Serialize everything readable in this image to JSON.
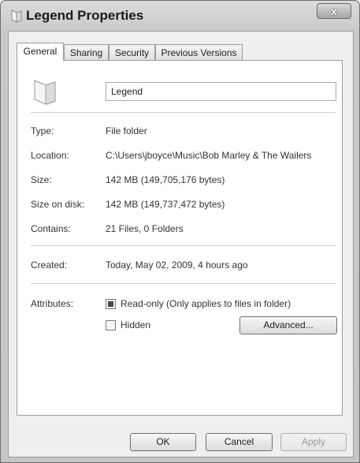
{
  "window": {
    "title": "Legend Properties",
    "close_glyph": "x"
  },
  "tabs": [
    {
      "label": "General"
    },
    {
      "label": "Sharing"
    },
    {
      "label": "Security"
    },
    {
      "label": "Previous Versions"
    }
  ],
  "general": {
    "name_value": "Legend",
    "rows": [
      {
        "label": "Type:",
        "value": "File folder"
      },
      {
        "label": "Location:",
        "value": "C:\\Users\\jboyce\\Music\\Bob Marley & The Wailers"
      },
      {
        "label": "Size:",
        "value": "142 MB (149,705,176 bytes)"
      },
      {
        "label": "Size on disk:",
        "value": "142 MB (149,737,472 bytes)"
      },
      {
        "label": "Contains:",
        "value": "21 Files, 0 Folders"
      }
    ],
    "created": {
      "label": "Created:",
      "value": "Today, May 02, 2009, 4 hours ago"
    },
    "attributes": {
      "label": "Attributes:",
      "readonly_label": "Read-only (Only applies to files in folder)",
      "readonly_state": "indeterminate",
      "hidden_label": "Hidden",
      "hidden_checked": false,
      "advanced_label": "Advanced..."
    }
  },
  "footer": {
    "ok_label": "OK",
    "cancel_label": "Cancel",
    "apply_label": "Apply"
  },
  "icons": {
    "title": "folder-icon",
    "large": "folder-icon",
    "close": "close-icon"
  }
}
